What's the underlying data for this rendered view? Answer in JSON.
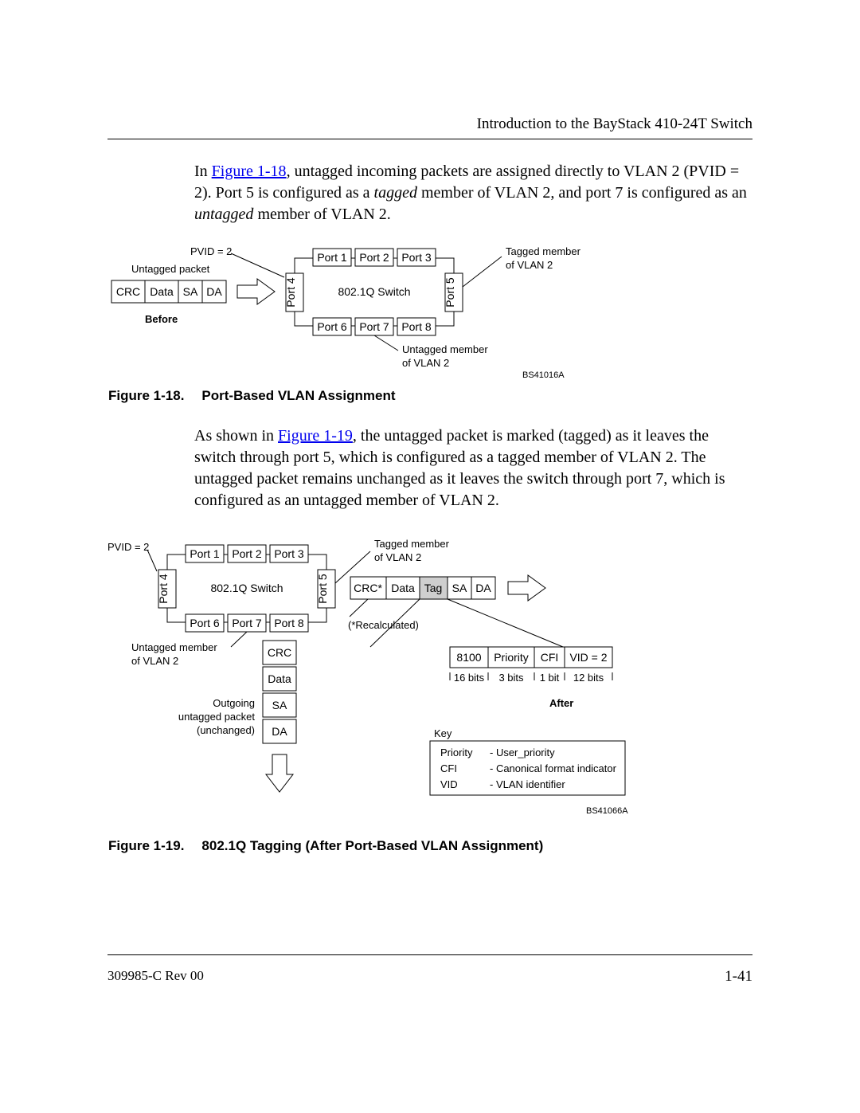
{
  "header": "Introduction to the BayStack 410-24T Switch",
  "footer_left": "309985-C Rev 00",
  "footer_right": "1-41",
  "para1": {
    "pre": "In ",
    "link": "Figure 1-18",
    "mid": ", untagged incoming packets are assigned directly to VLAN 2 (PVID = 2). Port 5 is configured as a ",
    "ital1": "tagged",
    "mid2": " member of VLAN 2, and port 7 is configured as an ",
    "ital2": "untagged",
    "post": " member of VLAN 2."
  },
  "fig18": {
    "label": "Figure 1-18.",
    "title": "Port-Based VLAN Assignment",
    "pvid": "PVID = 2",
    "untagged_packet": "Untagged packet",
    "pkt": {
      "crc": "CRC",
      "data": "Data",
      "sa": "SA",
      "da": "DA"
    },
    "before": "Before",
    "switch": "802.1Q Switch",
    "ports": {
      "p1": "Port 1",
      "p2": "Port 2",
      "p3": "Port 3",
      "p4": "Port 4",
      "p5": "Port 5",
      "p6": "Port 6",
      "p7": "Port 7",
      "p8": "Port 8"
    },
    "tagged_member": "Tagged member",
    "tagged_member2": "of VLAN 2",
    "untagged_member": "Untagged member",
    "untagged_member2": "of VLAN 2",
    "id": "BS41016A"
  },
  "para2": {
    "pre": "As shown in ",
    "link": "Figure 1-19",
    "post": ", the untagged packet is marked (tagged) as it leaves the switch through port 5, which is configured as a tagged member of VLAN 2. The untagged packet remains unchanged as it leaves the switch through port 7, which is configured as an untagged member of VLAN 2."
  },
  "fig19": {
    "label": "Figure 1-19.",
    "title": "802.1Q Tagging (After Port-Based VLAN Assignment)",
    "pvid": "PVID = 2",
    "switch": "802.1Q Switch",
    "ports": {
      "p1": "Port 1",
      "p2": "Port 2",
      "p3": "Port 3",
      "p4": "Port 4",
      "p5": "Port 5",
      "p6": "Port 6",
      "p7": "Port 7",
      "p8": "Port 8"
    },
    "tagged_member": "Tagged member",
    "tagged_member2": "of VLAN 2",
    "untagged_member": "Untagged member",
    "untagged_member2": "of VLAN 2",
    "pkt_out": {
      "crc": "CRC*",
      "data": "Data",
      "tag": "Tag",
      "sa": "SA",
      "da": "DA"
    },
    "recalc": "(*Recalculated)",
    "tag_fields": {
      "f1": "8100",
      "f2": "Priority",
      "f3": "CFI",
      "f4": "VID = 2"
    },
    "tag_bits": {
      "b1": "16 bits",
      "b2": "3 bits",
      "b3": "1 bit",
      "b4": "12 bits"
    },
    "vpkt": {
      "crc": "CRC",
      "data": "Data",
      "sa": "SA",
      "da": "DA"
    },
    "outgoing1": "Outgoing",
    "outgoing2": "untagged packet",
    "outgoing3": "(unchanged)",
    "after": "After",
    "key": "Key",
    "key_rows": {
      "r1a": "Priority",
      "r1b": "- User_priority",
      "r2a": "CFI",
      "r2b": "- Canonical format indicator",
      "r3a": "VID",
      "r3b": "- VLAN identifier"
    },
    "id": "BS41066A"
  }
}
